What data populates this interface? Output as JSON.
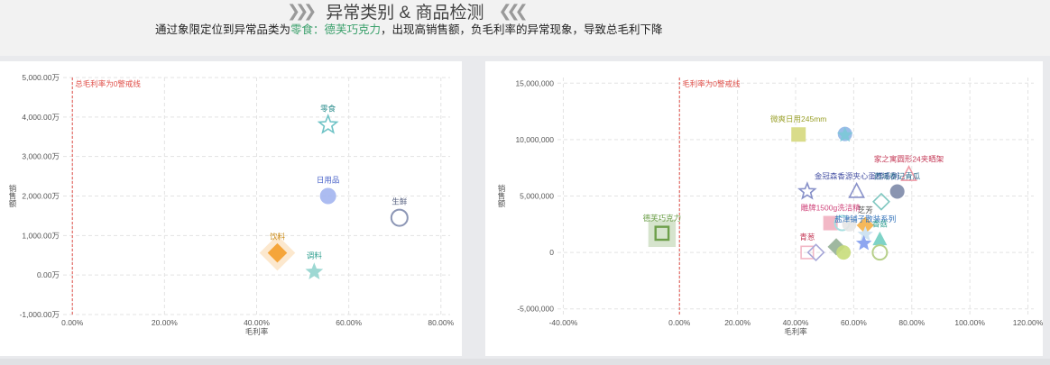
{
  "header": {
    "title": "异常类别 & 商品检测",
    "left_chevrons": "❯❯❯",
    "right_chevrons": "❮❮❮",
    "subtitle_pre": "通过象限定位到异常品类为",
    "subtitle_highlight": "零食：德芙巧克力",
    "subtitle_post": "，出现高销售额，负毛利率的异常现象，导致总毛利下降"
  },
  "chart_data": [
    {
      "type": "scatter",
      "title": "",
      "xlabel": "毛利率",
      "ylabel": "销售额",
      "xlim": [
        -0.02,
        0.82
      ],
      "ylim": [
        -1000,
        5000
      ],
      "xticks": [
        0,
        0.2,
        0.4,
        0.6,
        0.8
      ],
      "xtick_labels": [
        "0.00%",
        "20.00%",
        "40.00%",
        "60.00%",
        "80.00%"
      ],
      "yticks": [
        -1000,
        0,
        1000,
        2000,
        3000,
        4000,
        5000
      ],
      "ytick_labels": [
        "-1,000.00万",
        "0.00万",
        "1,000.00万",
        "2,000.00万",
        "3,000.00万",
        "4,000.00万",
        "5,000.00万"
      ],
      "grid": true,
      "ref_line": {
        "x": 0,
        "label": "总毛利率为0警戒线",
        "color": "#e0504a"
      },
      "points": [
        {
          "label": "零食",
          "x": 0.555,
          "y": 3800,
          "shape": "star-outline",
          "color": "#6fc3c6",
          "label_color": "#2f8f8f"
        },
        {
          "label": "日用品",
          "x": 0.555,
          "y": 2000,
          "shape": "circle",
          "color": "#a3b5ef",
          "label_color": "#4a63c9"
        },
        {
          "label": "生鲜",
          "x": 0.71,
          "y": 1450,
          "shape": "circle-outline",
          "color": "#8c96b5",
          "label_color": "#555f7f"
        },
        {
          "label": "饮料",
          "x": 0.445,
          "y": 560,
          "shape": "diamond-halo",
          "color": "#f5a53a",
          "label_color": "#c98a16"
        },
        {
          "label": "调料",
          "x": 0.525,
          "y": 80,
          "shape": "star",
          "color": "#9dd8d3",
          "label_color": "#2f9f8f"
        }
      ]
    },
    {
      "type": "scatter",
      "title": "",
      "xlabel": "毛利率",
      "ylabel": "销售额",
      "xlim": [
        -0.42,
        1.22
      ],
      "ylim": [
        -5500000,
        15500000
      ],
      "xticks": [
        -0.4,
        0,
        0.2,
        0.4,
        0.6,
        0.8,
        1.0,
        1.2
      ],
      "xtick_labels": [
        "-40.00%",
        "0.00%",
        "20.00%",
        "40.00%",
        "60.00%",
        "80.00%",
        "100.00%",
        "120.00%"
      ],
      "yticks": [
        -5000000,
        0,
        5000000,
        10000000,
        15000000
      ],
      "ytick_labels": [
        "-5,000,000",
        "0",
        "5,000,000",
        "10,000,000",
        "15,000,000"
      ],
      "grid": true,
      "ref_line": {
        "x": 0,
        "label": "毛利率为0警戒线",
        "color": "#e0504a"
      },
      "points": [
        {
          "label": "微爽日用245mm",
          "x": 0.41,
          "y": 10450000,
          "shape": "square",
          "color": "#d9dc8a",
          "label_color": "#9aa02a"
        },
        {
          "label": "",
          "x": 0.57,
          "y": 10500000,
          "shape": "circle",
          "color": "#8fb6e6"
        },
        {
          "label": "",
          "x": 0.57,
          "y": 10400000,
          "shape": "star",
          "color": "#7fc7d9"
        },
        {
          "label": "家之寓圆形24夹晒架",
          "x": 0.79,
          "y": 6900000,
          "shape": "triangle-outline",
          "color": "#ef9aa6",
          "label_color": "#c43a57"
        },
        {
          "label": "金冠森香源夹心蛋糕系列",
          "x": 0.61,
          "y": 5400000,
          "shape": "triangle-outline",
          "color": "#8891c9",
          "label_color": "#4b56a6"
        },
        {
          "label": "",
          "x": 0.44,
          "y": 5400000,
          "shape": "star-outline",
          "color": "#8891c9"
        },
        {
          "label": "西域春记青瓜",
          "x": 0.75,
          "y": 5400000,
          "shape": "circle",
          "color": "#7d8aa8",
          "label_color": "#2f6d8f"
        },
        {
          "label": "",
          "x": 0.695,
          "y": 4500000,
          "shape": "diamond-outline",
          "color": "#7fc7c0"
        },
        {
          "label": "雕牌1500g洗洁精",
          "x": 0.52,
          "y": 2600000,
          "shape": "square",
          "color": "#f2b8c6",
          "label_color": "#d0477c"
        },
        {
          "label": "",
          "x": 0.56,
          "y": 2600000,
          "shape": "circle-outline",
          "color": "#a8dfe0"
        },
        {
          "label": "",
          "x": 0.585,
          "y": 2500000,
          "shape": "circle",
          "color": "#e5e5e5"
        },
        {
          "label": "芝芳",
          "x": 0.64,
          "y": 2400000,
          "shape": "diamond",
          "color": "#f5b85a",
          "label_color": "#555555"
        },
        {
          "label": "德芙巧克力",
          "x": -0.06,
          "y": 1700000,
          "shape": "square-halo",
          "color": "#6d9f4a",
          "label_color": "#6d9f4a"
        },
        {
          "label": "盐津铺子散装系列",
          "x": 0.64,
          "y": 1600000,
          "shape": "star",
          "color": "#cfe3f2",
          "label_color": "#2f6fb8"
        },
        {
          "label": "香菇",
          "x": 0.69,
          "y": 1150000,
          "shape": "triangle",
          "color": "#7fd3c7",
          "label_color": "#2f9f8f"
        },
        {
          "label": "",
          "x": 0.635,
          "y": 800000,
          "shape": "star",
          "color": "#8ea6f0"
        },
        {
          "label": "",
          "x": 0.54,
          "y": 500000,
          "shape": "diamond",
          "color": "#9fb8a0"
        },
        {
          "label": "青葱",
          "x": 0.44,
          "y": 0,
          "shape": "square-outline",
          "color": "#f2b8c6",
          "label_color": "#c43a57"
        },
        {
          "label": "",
          "x": 0.47,
          "y": 0,
          "shape": "diamond-outline",
          "color": "#a7a7d8"
        },
        {
          "label": "",
          "x": 0.565,
          "y": 0,
          "shape": "circle",
          "color": "#c8dd7a"
        },
        {
          "label": "",
          "x": 0.69,
          "y": 0,
          "shape": "circle-outline",
          "color": "#b7d08a"
        }
      ]
    }
  ]
}
